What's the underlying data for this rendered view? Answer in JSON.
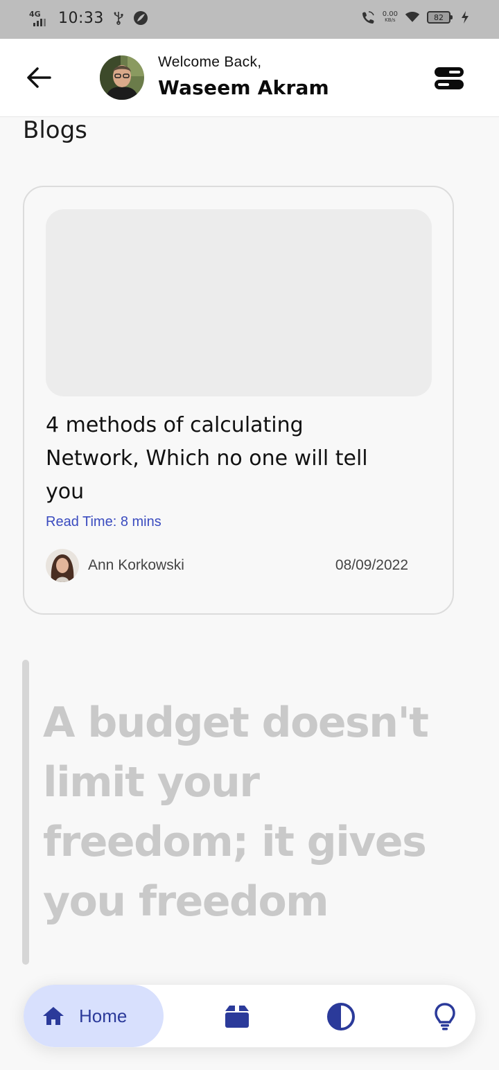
{
  "status_bar": {
    "network": "4G",
    "time": "10:33",
    "speed_value": "0.00",
    "speed_unit": "KB/s",
    "battery": "82"
  },
  "header": {
    "welcome": "Welcome Back,",
    "user_name": "Waseem Akram"
  },
  "section_title": "Blogs",
  "blog": {
    "title": "4 methods of calculating Network, Which no one will tell you",
    "read_time": "Read Time: 8 mins",
    "author": "Ann Korkowski",
    "date": "08/09/2022"
  },
  "quote": "A budget doesn't limit your freedom; it gives you freedom",
  "bottom_nav": {
    "home_label": "Home",
    "items": [
      "home-icon",
      "box-icon",
      "contrast-icon",
      "lightbulb-icon"
    ]
  },
  "colors": {
    "accent": "#2b3a9a",
    "nav_active_bg": "#d8e0fd",
    "link": "#3a4bbf"
  }
}
